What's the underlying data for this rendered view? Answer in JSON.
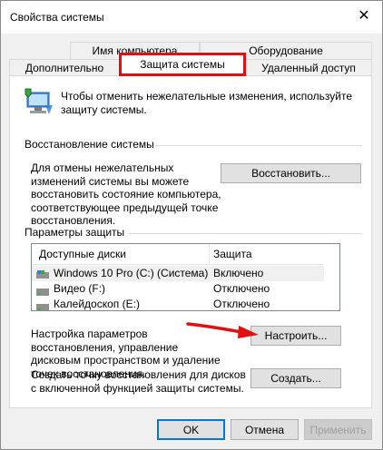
{
  "window": {
    "title": "Свойства системы",
    "close_glyph": "✕"
  },
  "tabs": {
    "computer_name": "Имя компьютера",
    "hardware": "Оборудование",
    "advanced": "Дополнительно",
    "system_protection": "Защита системы",
    "remote": "Удаленный доступ"
  },
  "intro": {
    "text": "Чтобы отменить нежелательные изменения, используйте защиту системы."
  },
  "restore_group": {
    "title": "Восстановление системы",
    "description": "Для отмены нежелательных изменений системы вы можете восстановить состояние компьютера, соответствующее предыдущей точке восстановления.",
    "button": "Восстановить..."
  },
  "protection_group": {
    "title": "Параметры защиты",
    "columns": [
      "Доступные диски",
      "Защита"
    ],
    "drives": [
      {
        "name": "Windows 10 Pro (C:) (Система)",
        "status": "Включено",
        "icon": "system-drive-icon"
      },
      {
        "name": "Видео (F:)",
        "status": "Отключено",
        "icon": "drive-icon"
      },
      {
        "name": "Калейдоскоп (E:)",
        "status": "Отключено",
        "icon": "drive-icon"
      }
    ],
    "configure_text": "Настройка параметров восстановления, управление дисковым пространством и удаление точек восстановления.",
    "configure_button": "Настроить...",
    "create_text": "Создать точку восстановления для дисков с включенной функцией защиты системы.",
    "create_button": "Создать..."
  },
  "footer": {
    "ok": "OK",
    "cancel": "Отмена",
    "apply": "Применить"
  },
  "colors": {
    "highlight": "#e01010",
    "accent": "#0078d7",
    "annotation_arrow": "#e01010"
  }
}
